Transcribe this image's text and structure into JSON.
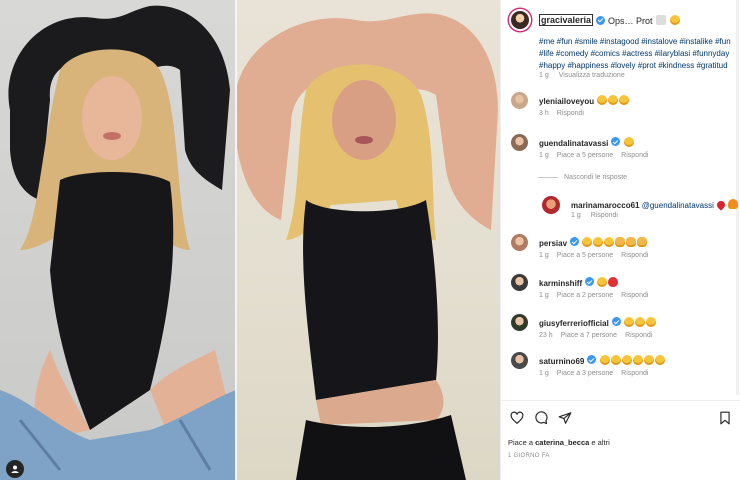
{
  "post": {
    "username": "gracivaleria",
    "caption_preview": "Ops… Prot",
    "hashtags": "#me #fun #smile #instagood #instalove #instalike #fun #life #comedy #comics #actress #ilaryblasi #funnyday #happy #happiness #lovely #prot #kindness #gratitud",
    "caption_time": "1 g",
    "translate_label": "Visualizza traduzione",
    "likes_prefix": "Piace a ",
    "likes_user": "caterina_becca",
    "likes_suffix": " e altri",
    "date": "1 GIORNO FA"
  },
  "comments": [
    {
      "user": "yleniailoveyou",
      "verified": false,
      "text": "",
      "emojis": [
        "laugh",
        "laugh",
        "laugh"
      ],
      "time": "3 h",
      "likes": "",
      "reply": "Rispondi",
      "avatar_color": "#c9a78a"
    },
    {
      "user": "guendalinatavassi",
      "verified": true,
      "text": "",
      "emojis": [
        "laugh"
      ],
      "time": "1 g",
      "likes": "Piace a 5 persone",
      "reply": "Rispondi",
      "avatar_color": "#8a6a52"
    },
    {
      "user": "persiav",
      "verified": true,
      "text": "",
      "emojis": [
        "laugh",
        "laugh",
        "laugh",
        "clap",
        "clap",
        "clap"
      ],
      "time": "1 g",
      "likes": "Piace a 5 persone",
      "reply": "Rispondi",
      "avatar_color": "#b07a60"
    },
    {
      "user": "karminshiff",
      "verified": true,
      "text": "",
      "emojis": [
        "laugh",
        "heart"
      ],
      "time": "1 g",
      "likes": "Piace a 2 persone",
      "reply": "Rispondi",
      "avatar_color": "#3a3a3a"
    },
    {
      "user": "giusyferreriofficial",
      "verified": true,
      "text": "",
      "emojis": [
        "laugh",
        "laugh",
        "laugh"
      ],
      "time": "23 h",
      "likes": "Piace a 7 persone",
      "reply": "Rispondi",
      "avatar_color": "#2f3b2a"
    },
    {
      "user": "saturnino69",
      "verified": true,
      "text": "",
      "emojis": [
        "laugh",
        "laugh",
        "laugh",
        "laugh",
        "laugh",
        "laugh"
      ],
      "time": "1 g",
      "likes": "Piace a 3 persone",
      "reply": "Rispondi",
      "avatar_color": "#4a4a4a"
    }
  ],
  "reply_toggle": "Nascondi le risposte",
  "reply": {
    "user": "marinamarocco61",
    "mention": "@guendalinatavassi",
    "time": "1 g",
    "reply": "Rispondi"
  },
  "colors": {
    "link": "#00376b",
    "muted": "#8e8e8e",
    "verified": "#3897f0"
  }
}
